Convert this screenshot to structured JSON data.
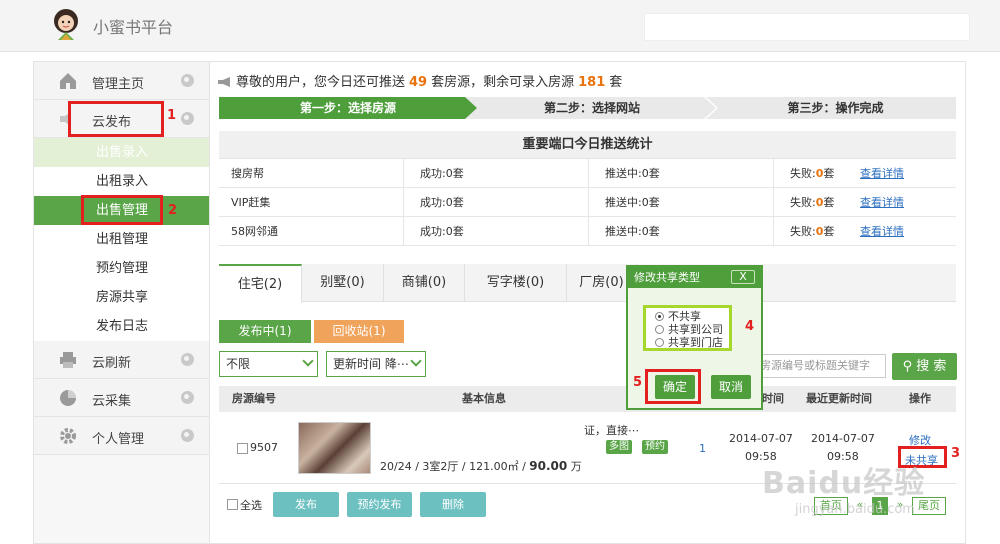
{
  "header": {
    "brand": "小蜜书平台"
  },
  "sidebar": {
    "groups": [
      {
        "label": "管理主页"
      },
      {
        "label": "云发布"
      },
      {
        "label": "云刷新"
      },
      {
        "label": "云采集"
      },
      {
        "label": "个人管理"
      }
    ],
    "subitems": [
      "出售录入",
      "出租录入",
      "出售管理",
      "出租管理",
      "预约管理",
      "房源共享",
      "发布日志"
    ]
  },
  "notice": {
    "prefix": "尊敬的用户，您今日还可推送",
    "push_count": "49",
    "mid": "套房源，剩余可录入房源",
    "remain_count": "181",
    "suffix": "套"
  },
  "steps": [
    "第一步：选择房源",
    "第二步：选择网站",
    "第三步：操作完成"
  ],
  "stats": {
    "title": "重要端口今日推送统计",
    "rows": [
      {
        "site": "搜房帮",
        "success": "成功:0套",
        "pushing": "推送中:0套",
        "fail_label": "失败:",
        "fail_value": "0",
        "fail_unit": "套",
        "link": "查看详情"
      },
      {
        "site": "VIP赶集",
        "success": "成功:0套",
        "pushing": "推送中:0套",
        "fail_label": "失败:",
        "fail_value": "0",
        "fail_unit": "套",
        "link": "查看详情"
      },
      {
        "site": "58网邻通",
        "success": "成功:0套",
        "pushing": "推送中:0套",
        "fail_label": "失败:",
        "fail_value": "0",
        "fail_unit": "套",
        "link": "查看详情"
      }
    ]
  },
  "tabs": [
    "住宅(2)",
    "别墅(0)",
    "商铺(0)",
    "写字楼(0)",
    "厂房(0)"
  ],
  "subtabs": [
    "发布中(1)",
    "回收站(1)"
  ],
  "filters": {
    "range": "不限",
    "sort": "更新时间 降⋯",
    "keyword_placeholder": "房源编号或标题关键字",
    "search_label": "搜 索"
  },
  "table": {
    "headers": [
      "房源编号",
      "基本信息",
      "时间",
      "最近更新时间",
      "操作"
    ],
    "row": {
      "id": "9507",
      "title_snippet": "证，直接⋯",
      "tags": [
        "多图",
        "预约"
      ],
      "detail_prefix": "20/24 / 3室2厅 / 121.00㎡ / ",
      "price": "90.00",
      "price_unit": "万",
      "count": "1",
      "created_date": "2014-07-07",
      "created_time": "09:58",
      "updated_date": "2014-07-07",
      "updated_time": "09:58",
      "edit": "修改",
      "share": "未共享"
    }
  },
  "bulk": {
    "select_all": "全选",
    "buttons": [
      "发布",
      "预约发布",
      "删除"
    ]
  },
  "pager": {
    "first": "首页",
    "prev": "«",
    "current": "1",
    "next": "»",
    "last": "尾页"
  },
  "dialog": {
    "title": "修改共享类型",
    "close": "X",
    "options": [
      "不共享",
      "共享到公司",
      "共享到门店"
    ],
    "selected": 0,
    "ok": "确定",
    "cancel": "取消"
  },
  "annotations": [
    "1",
    "2",
    "3",
    "4",
    "5"
  ],
  "watermark": {
    "main": "Baidu经验",
    "sub": "jingyan.baidu.com"
  },
  "colors": {
    "brand_green": "#5aa548",
    "accent_orange": "#e8720c",
    "annotation_red": "#e32020",
    "highlight_lime": "#a6d72c"
  }
}
